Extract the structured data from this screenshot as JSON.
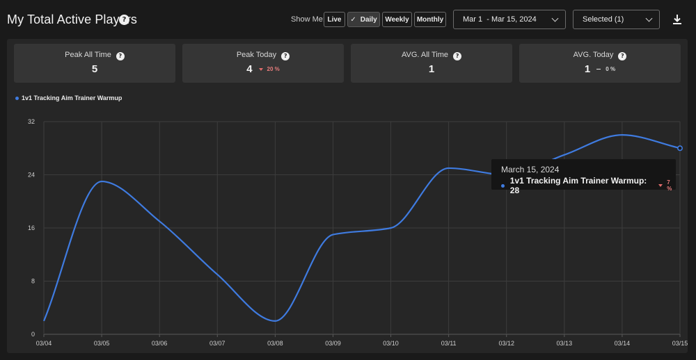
{
  "header": {
    "title": "My Total Active Players",
    "show_me_label": "Show Me:",
    "ranges": [
      {
        "label": "Live"
      },
      {
        "label": "Daily",
        "active": true,
        "icon": "check-icon"
      },
      {
        "label": "Weekly"
      },
      {
        "label": "Monthly"
      }
    ],
    "date_range": "Mar 1  - Mar 15, 2024",
    "selected_filter": "Selected (1)"
  },
  "stats": [
    {
      "label": "Peak All Time",
      "value": "5"
    },
    {
      "label": "Peak Today",
      "value": "4",
      "delta": "20 %",
      "trend": "down"
    },
    {
      "label": "AVG. All Time",
      "value": "1"
    },
    {
      "label": "AVG. Today",
      "value": "1",
      "delta": "0 %",
      "trend": "flat"
    }
  ],
  "colors": {
    "accent": "#3f7be0",
    "negative": "#e87d7d",
    "background": "#1a1a1a",
    "panel": "#262626",
    "card": "#353535"
  },
  "tooltip": {
    "date": "March 15, 2024",
    "series": "1v1 Tracking Aim Trainer Warmup",
    "value": "28",
    "label": "1v1 Tracking Aim Trainer Warmup: 28",
    "delta": "7 %",
    "trend": "down"
  },
  "chart_data": {
    "type": "line",
    "title": "",
    "xlabel": "",
    "ylabel": "",
    "categories": [
      "03/04",
      "03/05",
      "03/06",
      "03/07",
      "03/08",
      "03/09",
      "03/10",
      "03/11",
      "03/12",
      "03/13",
      "03/14",
      "03/15"
    ],
    "series": [
      {
        "name": "1v1 Tracking Aim Trainer Warmup",
        "values": [
          2,
          23,
          17,
          9,
          2,
          15,
          16,
          25,
          24,
          27,
          30,
          28
        ]
      }
    ],
    "ylim": [
      0,
      32
    ],
    "yticks": [
      0,
      8,
      16,
      24,
      32
    ],
    "grid": true,
    "legend": "top-left"
  }
}
